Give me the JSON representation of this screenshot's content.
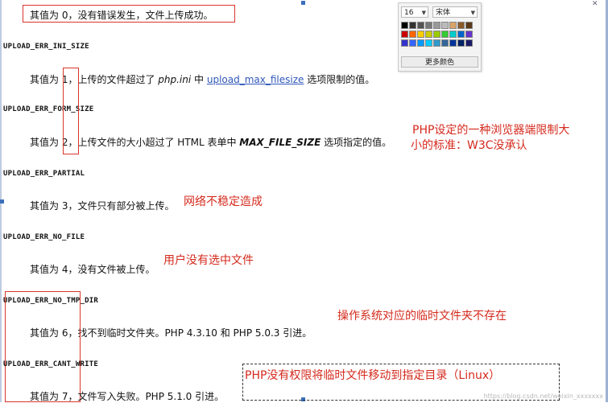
{
  "entries": [
    {
      "const": "",
      "desc_pre": "其值为 0，没有错误发生，文件上传成功。"
    },
    {
      "const": "UPLOAD_ERR_INI_SIZE",
      "desc_pre": "其值为 1，上传的文件超过了 ",
      "desc_code": "php.ini",
      "desc_mid": " 中 ",
      "desc_link": "upload_max_filesize",
      "desc_post": " 选项限制的值。"
    },
    {
      "const": "UPLOAD_ERR_FORM_SIZE",
      "desc_pre": "其值为 2，上传文件的大小超过了 HTML 表单中 ",
      "desc_bold": "MAX_FILE_SIZE",
      "desc_post": " 选项指定的值。"
    },
    {
      "const": "UPLOAD_ERR_PARTIAL",
      "desc_pre": "其值为 3，文件只有部分被上传。"
    },
    {
      "const": "UPLOAD_ERR_NO_FILE",
      "desc_pre": "其值为 4，没有文件被上传。"
    },
    {
      "const": "UPLOAD_ERR_NO_TMP_DIR",
      "desc_pre": "其值为 6，找不到临时文件夹。PHP 4.3.10 和 PHP 5.0.3 引进。"
    },
    {
      "const": "UPLOAD_ERR_CANT_WRITE",
      "desc_pre": "其值为 7，文件写入失败。PHP 5.1.0 引进。"
    }
  ],
  "annotations": {
    "form_size_line1": "PHP设定的一种浏览器端限制大",
    "form_size_line2": "小的标准：W3C没承认",
    "partial": "网络不稳定造成",
    "no_file": "用户没有选中文件",
    "no_tmp_dir": "操作系统对应的临时文件夹不存在",
    "cant_write": "PHP没有权限将临时文件移动到指定目录（Linux）"
  },
  "font_picker": {
    "size_value": "16",
    "font_value": "宋体",
    "more_colors_label": "更多颜色",
    "swatch_rows": [
      [
        "#000000",
        "#333333",
        "#555555",
        "#777777",
        "#999999",
        "#bbbbbb",
        "#d9a46a",
        "#8a5a2b",
        "#5a3a1a"
      ],
      [
        "#cc0000",
        "#ff6600",
        "#ffcc00",
        "#cccc00",
        "#99cc00",
        "#33cc33",
        "#00cccc",
        "#0066cc",
        "#6633cc"
      ],
      [
        "#3333cc",
        "#3366ff",
        "#0099ff",
        "#00ccff",
        "#3399cc",
        "#336699",
        "#003399",
        "#002266",
        "#1a1a66"
      ]
    ]
  },
  "watermark": "https://blog.csdn.net/weixin_xxxxxxx",
  "colors": {
    "annotation": "#d42a1d",
    "link": "#2f57b8"
  }
}
